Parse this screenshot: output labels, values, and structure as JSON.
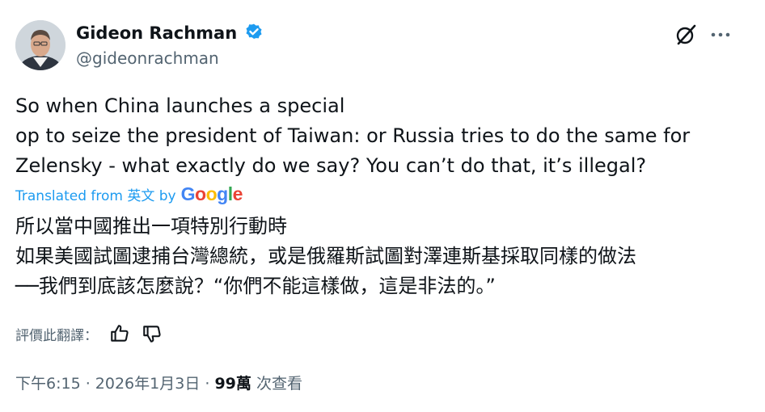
{
  "author": {
    "name": "Gideon Rachman",
    "handle": "@gideonrachman"
  },
  "tweet": {
    "text_lines": [
      "So when China launches a special",
      "op to seize the president of Taiwan: or Russia tries to do the same for",
      "Zelensky - what exactly do we say? You can’t do that, it’s illegal?"
    ],
    "translated_label": "Translated from 英文 by",
    "translator_logo": "Google",
    "translation_lines": [
      "所以當中國推出一項特別行動時",
      "如果美國試圖逮捕台灣總統，或是俄羅斯試圖對澤連斯基採取同樣的做法",
      "──我們到底該怎麼說？“你們不能這樣做，這是非法的。”"
    ]
  },
  "rating": {
    "label": "評價此翻譯："
  },
  "meta": {
    "time": "下午6:15",
    "sep1": " · ",
    "date": "2026年1月3日",
    "sep2": " · ",
    "views": "99萬",
    "views_label": " 次查看"
  },
  "colors": {
    "verified": "#1d9bf0",
    "link": "#1d9bf0",
    "secondary_text": "#536471",
    "primary_text": "#0f1419"
  }
}
